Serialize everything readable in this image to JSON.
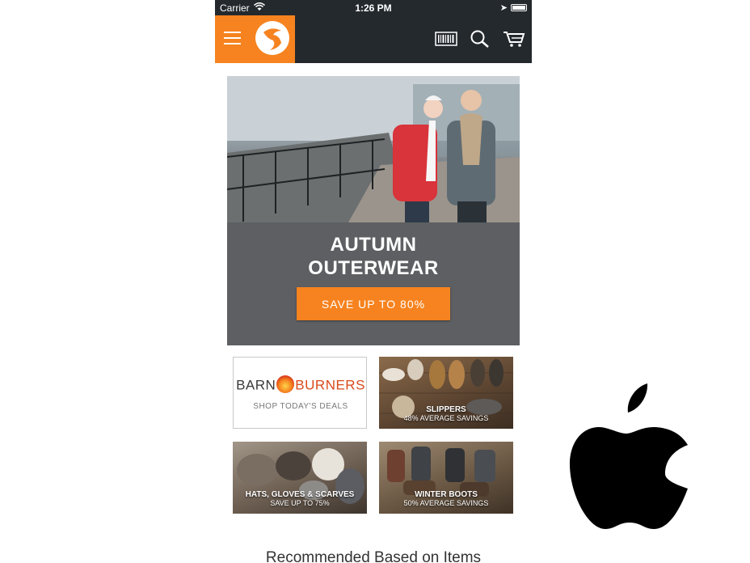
{
  "status_bar": {
    "carrier": "Carrier",
    "time": "1:26 PM"
  },
  "app_bar": {
    "menu_icon": "hamburger-icon",
    "logo_icon": "brand-logo-icon",
    "actions": [
      "barcode-icon",
      "search-icon",
      "cart-icon"
    ]
  },
  "banner": {
    "title_line1": "AUTUMN",
    "title_line2": "OUTERWEAR",
    "button_label": "SAVE UP TO 80%"
  },
  "tiles": [
    {
      "brand_left": "BARN",
      "brand_right": "BURNERS",
      "subtitle": "SHOP TODAY'S DEALS"
    },
    {
      "title": "SLIPPERS",
      "subtitle": "48% AVERAGE SAVINGS"
    },
    {
      "title": "HATS, GLOVES & SCARVES",
      "subtitle": "SAVE UP TO 75%"
    },
    {
      "title": "WINTER BOOTS",
      "subtitle": "50% AVERAGE SAVINGS"
    }
  ],
  "recommended_heading": "Recommended Based on Items",
  "colors": {
    "accent": "#f6831f",
    "bar": "#24292e",
    "banner_panel": "#5d5f62"
  }
}
